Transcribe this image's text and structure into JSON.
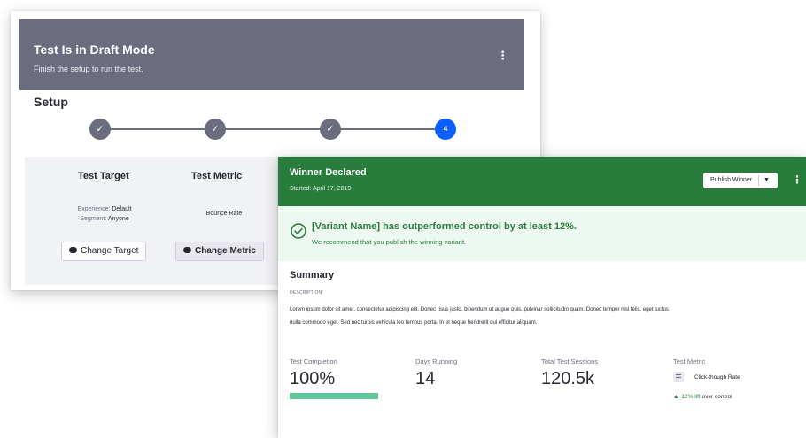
{
  "draft": {
    "title": "Test Is in Draft Mode",
    "subtitle": "Finish the setup to run the test.",
    "kebab": "⋮",
    "setup_title": "Setup",
    "steps": [
      {
        "label": "✓",
        "state": "done"
      },
      {
        "label": "✓",
        "state": "done"
      },
      {
        "label": "✓",
        "state": "done"
      },
      {
        "label": "4",
        "state": "active"
      }
    ],
    "target": {
      "title": "Test Target",
      "experience_label": "Experience:",
      "experience_value": "Default",
      "segment_label": "Segment:",
      "segment_value": "Anyone",
      "button": "Change Target"
    },
    "metric": {
      "title": "Test Metric",
      "value": "Bounce Rate",
      "button": "Change Metric"
    }
  },
  "winner": {
    "title": "Winner Declared",
    "started": "Started: April 17, 2019",
    "publish_button": "Publish Winner",
    "publish_caret": "▼",
    "kebab": "⋮",
    "alert_title": "[Variant Name] has outperformed control by at least 12%.",
    "alert_subtitle": "We recommend that you publish the winning variant.",
    "summary_title": "Summary",
    "description_label": "DESCRIPTION",
    "description": "Lorem ipsum dolor sit amet, consectetur adipiscing elit. Donec risus justo, bibendum ut augue quis, pulvinar sollicitudin quam. Donec tempor nisl felis, eget luctus nulla commodo eget. Sed nec turpis vehicula leo tempus porta. In et neque hendrerit dui efficitur aliquam.",
    "completion_label": "Test Completion",
    "completion_value": "100%",
    "completion_fraction": 1.0,
    "days_label": "Days Running",
    "days_value": "14",
    "sessions_label": "Total Test Sessions",
    "sessions_value": "120.5k",
    "test_metric_label": "Test Metric",
    "test_metric_value": "Click-though Rate",
    "lift_arrow": "▲",
    "lift_value": "12% lift",
    "lift_suffix": "over control"
  },
  "colors": {
    "draft_header": "#6b6c7e",
    "step_active": "#0b5fff",
    "winner_header": "#287d3c",
    "alert_bg": "#edf9f0",
    "progress": "#5fc79a"
  }
}
